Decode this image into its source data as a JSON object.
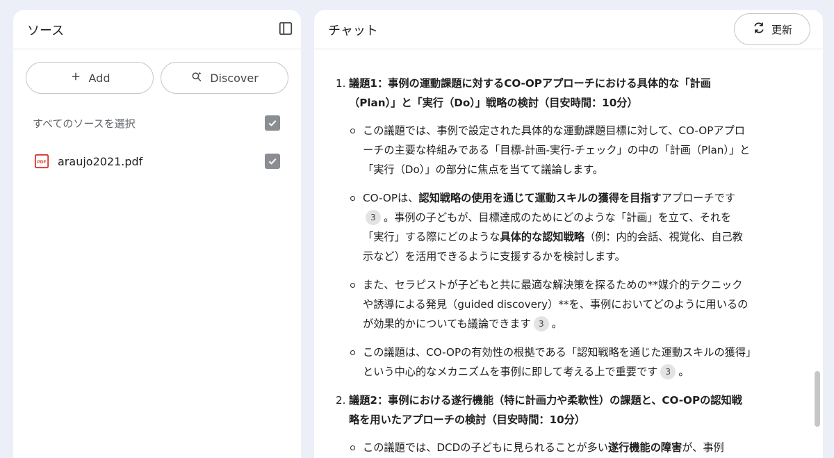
{
  "sources": {
    "title": "ソース",
    "add_label": "Add",
    "discover_label": "Discover",
    "select_all_label": "すべてのソースを選択",
    "items": [
      {
        "name": "araujo2021.pdf",
        "icon": "pdf-icon",
        "checked": true
      }
    ]
  },
  "chat": {
    "title": "チャット",
    "refresh_label": "更新",
    "topic1": {
      "number": "1.",
      "title": "議題1：事例の運動課題に対するCO-OPアプローチにおける具体的な「計画（Plan）」と「実行（Do）」戦略の検討（目安時間：10分）",
      "b1": "この議題では、事例で設定された具体的な運動課題目標に対して、CO-OPアプローチの主要な枠組みである「目標-計画-実行-チェック」の中の「計画（Plan）」と「実行（Do）」の部分に焦点を当てて議論します。",
      "b2_pre": "CO-OPは、",
      "b2_bold": "認知戦略の使用を通じて運動スキルの獲得を目指す",
      "b2_mid": "アプローチです",
      "b2_post": "。事例の子どもが、目標達成のためにどのような「計画」を立て、それを「実行」する際にどのような",
      "b2_bold2": "具体的な認知戦略",
      "b2_end": "（例：内的会話、視覚化、自己教示など）を活用できるように支援するかを検討します。",
      "b3": "また、セラピストが子どもと共に最適な解決策を探るための**媒介的テクニックや誘導による発見（guided discovery）**を、事例においてどのように用いるのが効果的かについても議論できます",
      "b3_end": "。",
      "b4": "この議題は、CO-OPの有効性の根拠である「認知戦略を通じた運動スキルの獲得」という中心的なメカニズムを事例に即して考える上で重要です",
      "b4_end": "。"
    },
    "topic2": {
      "number": "2.",
      "title": "議題2：事例における遂行機能（特に計画力や柔軟性）の課題と、CO-OPの認知戦略を用いたアプローチの検討（目安時間：10分）",
      "b1_pre": "この議題では、DCDの子どもに見られることが多い",
      "b1_bold": "遂行機能の障害",
      "b1_post": "が、事例"
    },
    "citation": "3"
  }
}
